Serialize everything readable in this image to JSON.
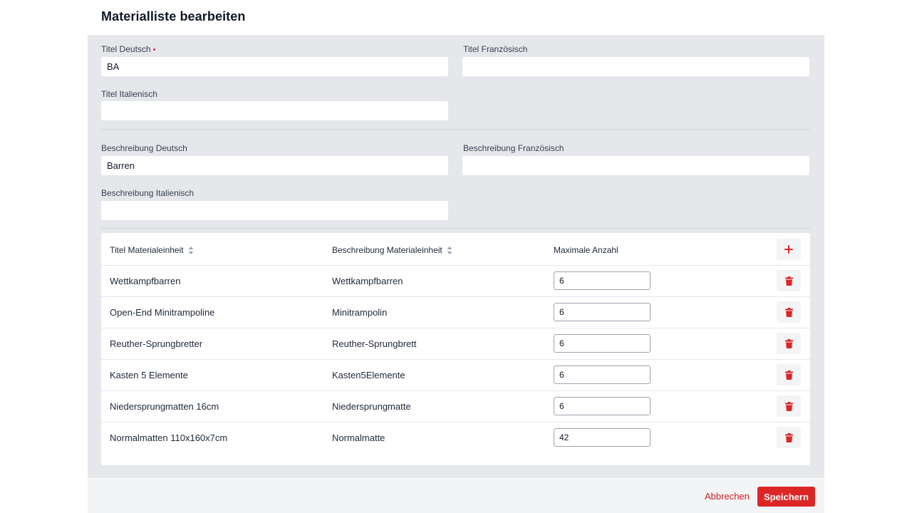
{
  "dialog": {
    "title": "Materialliste bearbeiten"
  },
  "fields": {
    "title_de": {
      "label": "Titel Deutsch",
      "required_marker": "•",
      "value": "BA",
      "placeholder": ""
    },
    "title_fr": {
      "label": "Titel Französisch",
      "value": "",
      "placeholder": ""
    },
    "title_it": {
      "label": "Titel Italienisch",
      "value": "",
      "placeholder": ""
    },
    "desc_de": {
      "label": "Beschreibung Deutsch",
      "value": "Barren",
      "placeholder": ""
    },
    "desc_fr": {
      "label": "Beschreibung Französisch",
      "value": "",
      "placeholder": ""
    },
    "desc_it": {
      "label": "Beschreibung Italienisch",
      "value": "",
      "placeholder": ""
    }
  },
  "table": {
    "headers": {
      "title": "Titel Materialeinheit",
      "description": "Beschreibung Materialeinheit",
      "max_count": "Maximale Anzahl"
    },
    "rows": [
      {
        "title": "Wettkampfbarren",
        "description": "Wettkampfbarren",
        "max_count": "6"
      },
      {
        "title": "Open-End Minitrampoline",
        "description": "Minitrampolin",
        "max_count": "6"
      },
      {
        "title": "Reuther-Sprungbretter",
        "description": "Reuther-Sprungbrett",
        "max_count": "6"
      },
      {
        "title": "Kasten 5 Elemente",
        "description": "Kasten5Elemente",
        "max_count": "6"
      },
      {
        "title": "Niedersprungmatten 16cm",
        "description": "Niedersprungmatte",
        "max_count": "6"
      },
      {
        "title": "Normalmatten 110x160x7cm",
        "description": "Normalmatte",
        "max_count": "42"
      }
    ]
  },
  "icons": {
    "add": "plus-icon",
    "delete": "trash-icon",
    "sort": "sort-icon"
  },
  "footer": {
    "cancel_label": "Abbrechen",
    "save_label": "Speichern"
  },
  "colors": {
    "accent": "#dc2626",
    "panel_bg": "#e6e7ea"
  }
}
